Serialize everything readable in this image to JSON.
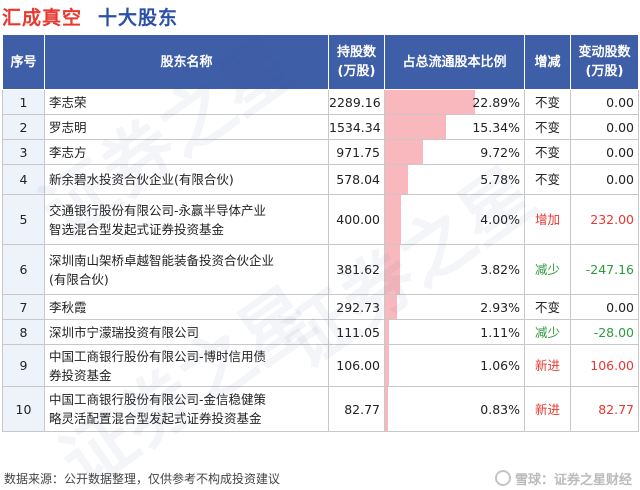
{
  "header": {
    "company": "汇成真空",
    "title": "十大股东"
  },
  "columns": {
    "idx": "序号",
    "name": "股东名称",
    "shares_l1": "持股数",
    "shares_l2": "(万股)",
    "ratio": "占总流通股本比例",
    "change": "增减",
    "delta_l1": "变动股数",
    "delta_l2": "(万股)"
  },
  "rows": [
    {
      "idx": "1",
      "name_l1": "李志荣",
      "name_l2": "",
      "shares": "2289.16",
      "ratio": "22.89%",
      "ratio_value": 22.89,
      "change": "不变",
      "delta": "0.00",
      "tone": ""
    },
    {
      "idx": "2",
      "name_l1": "罗志明",
      "name_l2": "",
      "shares": "1534.34",
      "ratio": "15.34%",
      "ratio_value": 15.34,
      "change": "不变",
      "delta": "0.00",
      "tone": ""
    },
    {
      "idx": "3",
      "name_l1": "李志方",
      "name_l2": "",
      "shares": "971.75",
      "ratio": "9.72%",
      "ratio_value": 9.72,
      "change": "不变",
      "delta": "0.00",
      "tone": ""
    },
    {
      "idx": "4",
      "name_l1": "新余碧水投资合伙企业(有限合伙)",
      "name_l2": "",
      "shares": "578.04",
      "ratio": "5.78%",
      "ratio_value": 5.78,
      "change": "不变",
      "delta": "0.00",
      "tone": ""
    },
    {
      "idx": "5",
      "name_l1": "交通银行股份有限公司-永赢半导体产业",
      "name_l2": "智选混合型发起式证券投资基金",
      "shares": "400.00",
      "ratio": "4.00%",
      "ratio_value": 4.0,
      "change": "增加",
      "delta": "232.00",
      "tone": "red"
    },
    {
      "idx": "6",
      "name_l1": "深圳南山架桥卓越智能装备投资合伙企业",
      "name_l2": "(有限合伙)",
      "shares": "381.62",
      "ratio": "3.82%",
      "ratio_value": 3.82,
      "change": "减少",
      "delta": "-247.16",
      "tone": "green"
    },
    {
      "idx": "7",
      "name_l1": "李秋霞",
      "name_l2": "",
      "shares": "292.73",
      "ratio": "2.93%",
      "ratio_value": 2.93,
      "change": "不变",
      "delta": "0.00",
      "tone": ""
    },
    {
      "idx": "8",
      "name_l1": "深圳市宁濛瑞投资有限公司",
      "name_l2": "",
      "shares": "111.05",
      "ratio": "1.11%",
      "ratio_value": 1.11,
      "change": "减少",
      "delta": "-28.00",
      "tone": "green"
    },
    {
      "idx": "9",
      "name_l1": "中国工商银行股份有限公司-博时信用债",
      "name_l2": "券投资基金",
      "shares": "106.00",
      "ratio": "1.06%",
      "ratio_value": 1.06,
      "change": "新进",
      "delta": "106.00",
      "tone": "red"
    },
    {
      "idx": "10",
      "name_l1": "中国工商银行股份有限公司-金信稳健策",
      "name_l2": "略灵活配置混合型发起式证券投资基金",
      "shares": "82.77",
      "ratio": "0.83%",
      "ratio_value": 0.83,
      "change": "新进",
      "delta": "82.77",
      "tone": "red"
    }
  ],
  "footer": {
    "source": "数据来源：公开数据整理，仅供参考不构成投资建议",
    "brand": "雪球：证券之星财经"
  }
}
